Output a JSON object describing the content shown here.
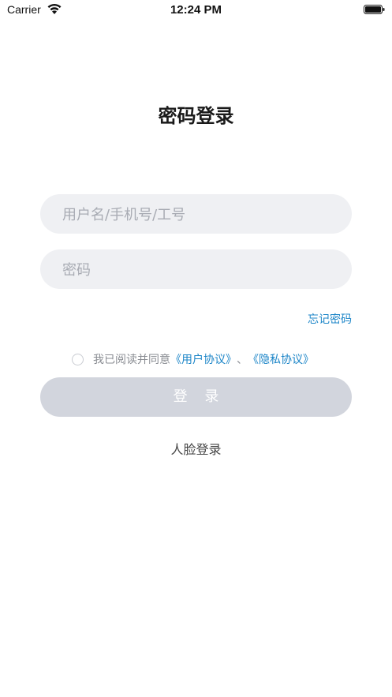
{
  "status_bar": {
    "carrier": "Carrier",
    "time": "12:24 PM",
    "wifi_icon": "wifi-icon",
    "battery_icon": "battery-icon"
  },
  "page": {
    "title": "密码登录"
  },
  "form": {
    "username_placeholder": "用户名/手机号/工号",
    "username_value": "",
    "password_placeholder": "密码",
    "password_value": "",
    "forgot_password": "忘记密码"
  },
  "agreement": {
    "checked": false,
    "prefix": "我已阅读并同意",
    "user_agreement": "《用户协议》",
    "separator": "、",
    "privacy_policy": "《隐私协议》"
  },
  "actions": {
    "login_label": "登 录",
    "face_login_label": "人脸登录"
  },
  "colors": {
    "accent": "#1d86c8",
    "field_bg": "#eff0f3",
    "button_disabled": "#d2d5dd"
  }
}
